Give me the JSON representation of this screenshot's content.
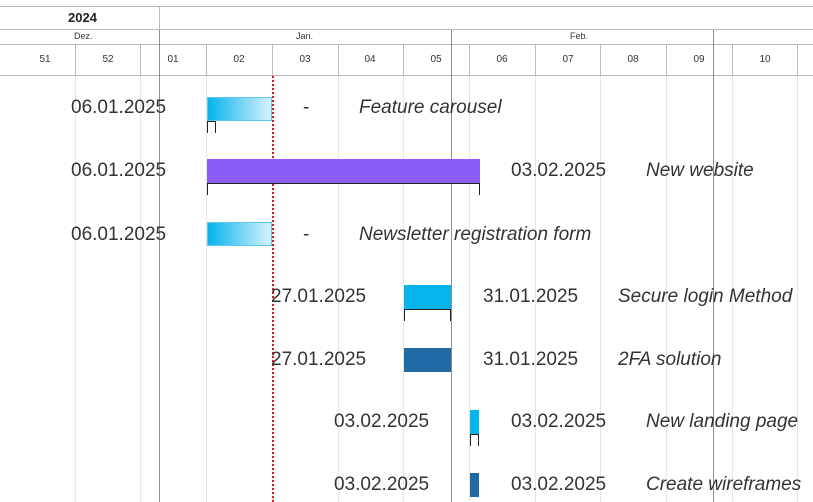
{
  "timeline": {
    "year": "2024",
    "months": [
      "Dez.",
      "Jan.",
      "Feb."
    ],
    "weeks": [
      "51",
      "52",
      "01",
      "02",
      "03",
      "04",
      "05",
      "06",
      "07",
      "08",
      "09",
      "10"
    ]
  },
  "tasks": [
    {
      "start": "06.01.2025",
      "end": "-",
      "name": "Feature carousel",
      "bar_color": "gradient-blue"
    },
    {
      "start": "06.01.2025",
      "end": "03.02.2025",
      "name": "New website",
      "bar_color": "#8b5cf6"
    },
    {
      "start": "06.01.2025",
      "end": "-",
      "name": "Newsletter registration form",
      "bar_color": "gradient-blue"
    },
    {
      "start": "27.01.2025",
      "end": "31.01.2025",
      "name": "Secure login Method",
      "bar_color": "#06b4ec"
    },
    {
      "start": "27.01.2025",
      "end": "31.01.2025",
      "name": "2FA solution",
      "bar_color": "#1f6aa5"
    },
    {
      "start": "03.02.2025",
      "end": "03.02.2025",
      "name": "New landing page",
      "bar_color": "#06b4ec"
    },
    {
      "start": "03.02.2025",
      "end": "03.02.2025",
      "name": "Create wireframes",
      "bar_color": "#1f6aa5"
    }
  ],
  "colors": {
    "today_line": "#e01818",
    "purple": "#8b5cf6",
    "light_blue": "#06b4ec",
    "dark_blue": "#1f6aa5"
  }
}
